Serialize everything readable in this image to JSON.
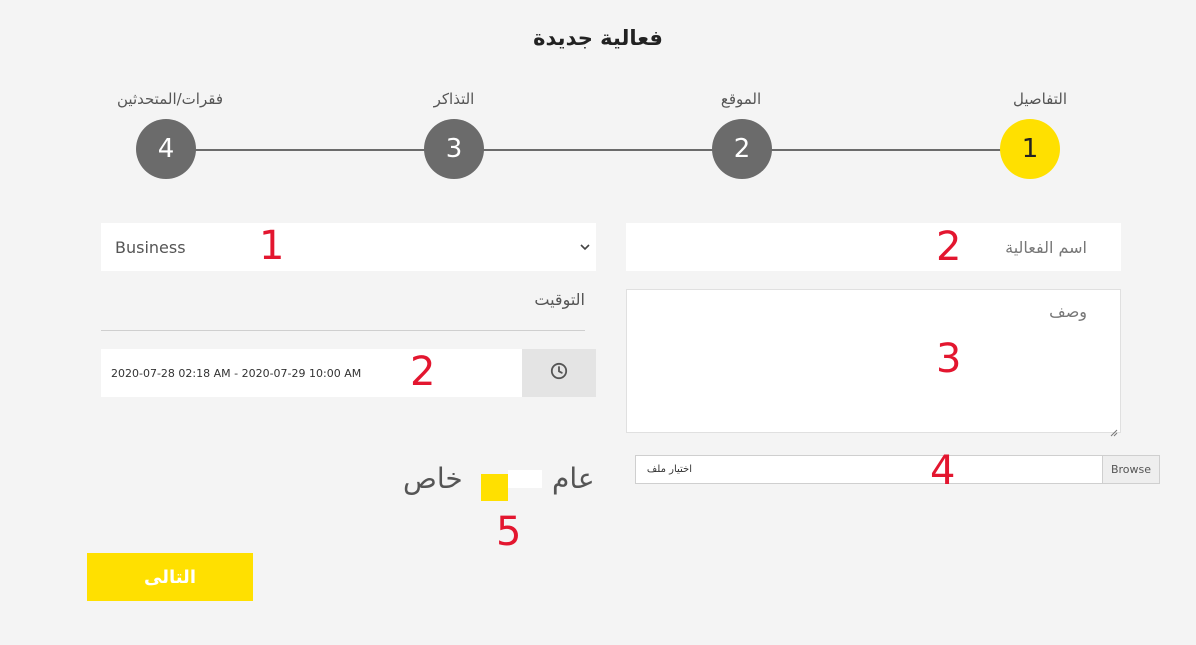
{
  "page_title": "فعالية جديدة",
  "steps": [
    {
      "number": "1",
      "label": "التفاصيل",
      "active": true
    },
    {
      "number": "2",
      "label": "الموقع",
      "active": false
    },
    {
      "number": "3",
      "label": "التذاكر",
      "active": false
    },
    {
      "number": "4",
      "label": "فقرات/المتحدثين",
      "active": false
    }
  ],
  "category_select": {
    "value": "Business"
  },
  "event_name": {
    "placeholder": "اسم الفعالية"
  },
  "description": {
    "placeholder": "وصف"
  },
  "timing": {
    "label": "التوقيت",
    "value": "2020-07-28 02:18 AM - 2020-07-29 10:00 AM"
  },
  "file_upload": {
    "placeholder": "اختيار ملف",
    "browse_label": "Browse"
  },
  "visibility": {
    "public_label": "عام",
    "private_label": "خاص",
    "selected": "private"
  },
  "next_button": {
    "label": "التالى"
  },
  "annotations": {
    "category": "1",
    "event_name": "2",
    "date": "2",
    "description": "3",
    "file": "4",
    "visibility": "5"
  },
  "colors": {
    "accent": "#ffe000",
    "step_inactive": "#6b6b6b",
    "annotation": "#e3162f",
    "background": "#f4f4f4"
  },
  "icons": {
    "clock": "clock-icon",
    "chevron": "chevron-down-icon"
  }
}
